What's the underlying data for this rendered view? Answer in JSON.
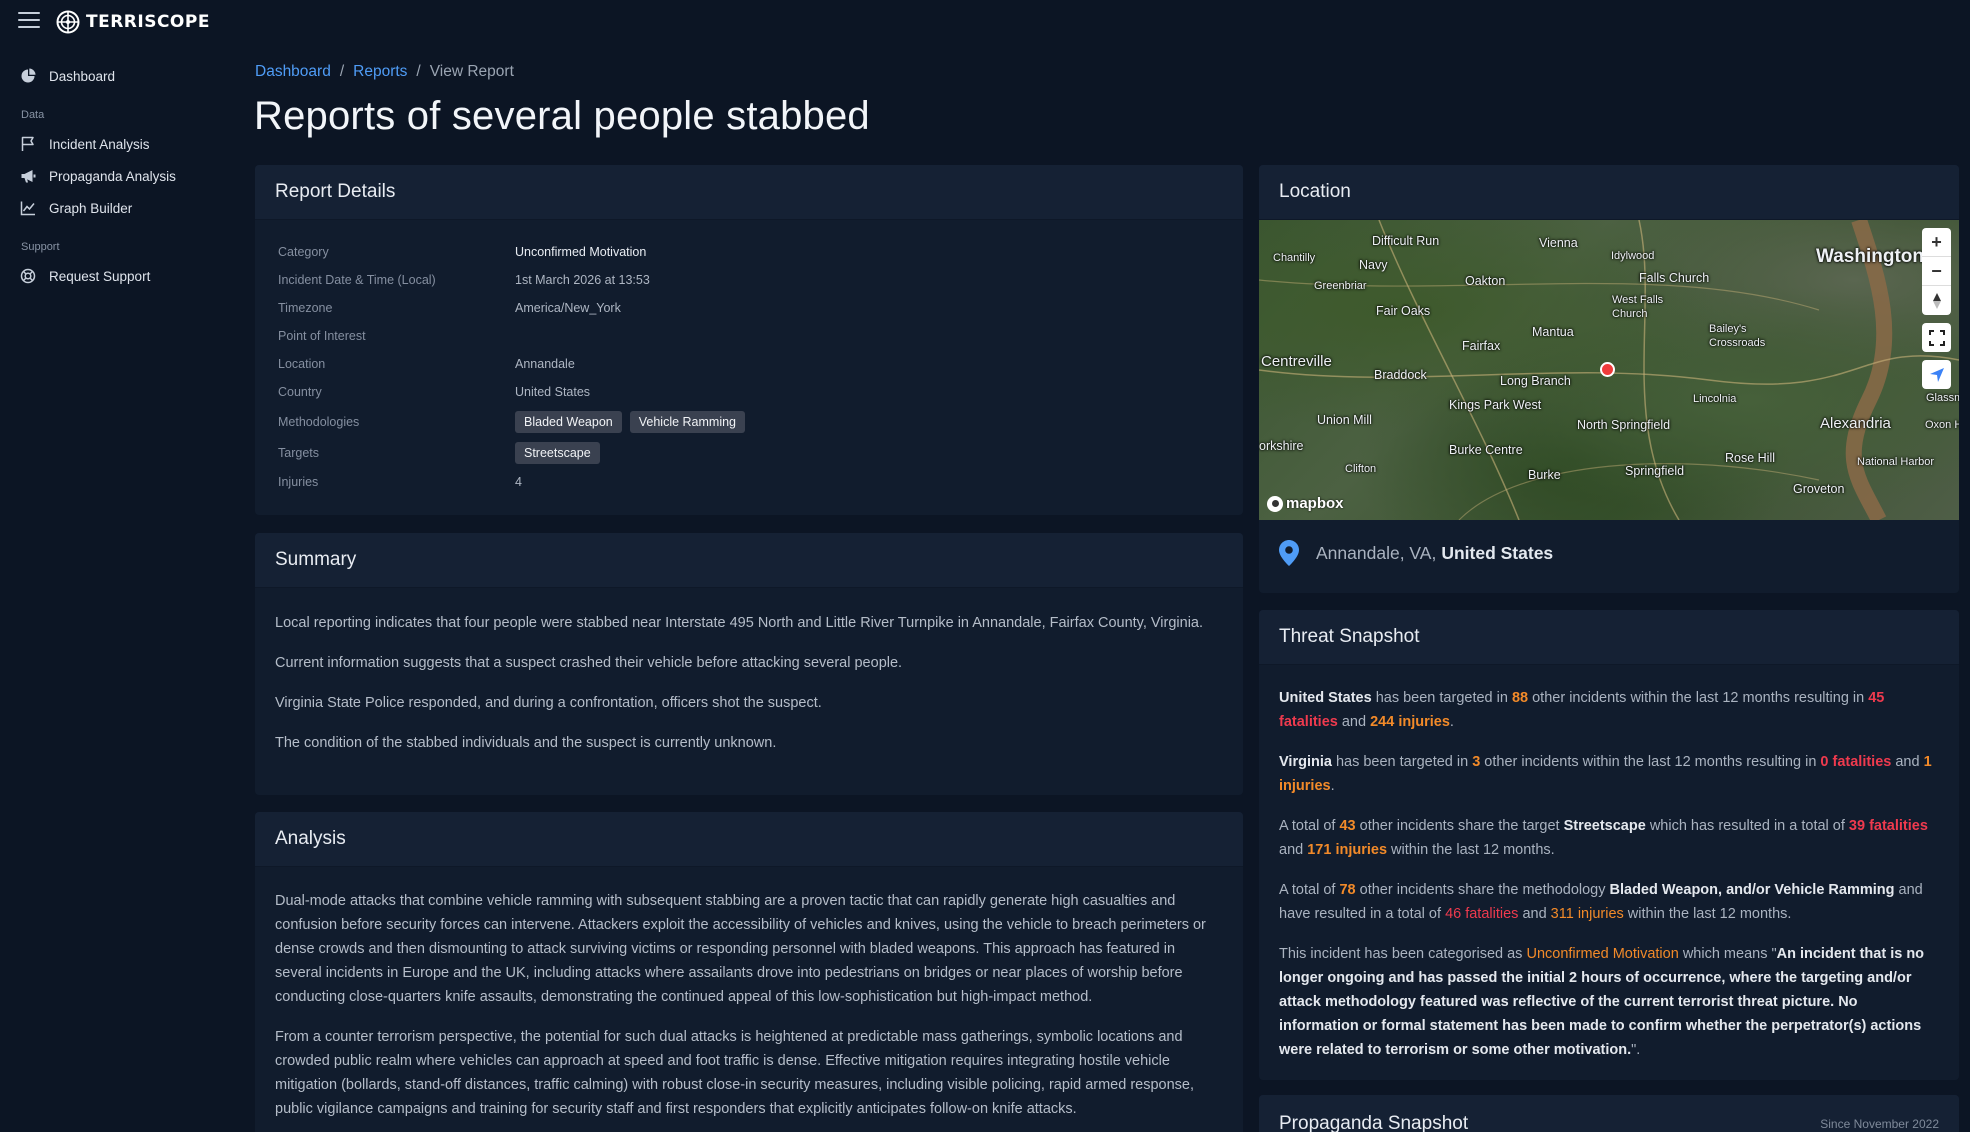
{
  "app": {
    "brand": "TERRISCOPE"
  },
  "sidebar": {
    "items_top": [
      {
        "label": "Dashboard",
        "icon": "pie-chart-icon"
      }
    ],
    "section_data": "Data",
    "items_data": [
      {
        "label": "Incident Analysis",
        "icon": "flag-icon"
      },
      {
        "label": "Propaganda Analysis",
        "icon": "megaphone-icon"
      },
      {
        "label": "Graph Builder",
        "icon": "line-chart-icon"
      }
    ],
    "section_support": "Support",
    "items_support": [
      {
        "label": "Request Support",
        "icon": "lifebuoy-icon"
      }
    ]
  },
  "breadcrumb": {
    "dashboard": "Dashboard",
    "reports": "Reports",
    "current": "View Report",
    "sep": "/"
  },
  "page_title": "Reports of several people stabbed",
  "report_details": {
    "title": "Report Details",
    "rows": {
      "category": {
        "label": "Category",
        "value": "Unconfirmed Motivation"
      },
      "datetime": {
        "label": "Incident Date & Time (Local)",
        "value": "1st March 2026 at 13:53"
      },
      "timezone": {
        "label": "Timezone",
        "value": "America/New_York"
      },
      "poi": {
        "label": "Point of Interest",
        "value": ""
      },
      "location": {
        "label": "Location",
        "value": "Annandale"
      },
      "country": {
        "label": "Country",
        "value": "United States"
      },
      "methodologies": {
        "label": "Methodologies",
        "tags": [
          "Bladed Weapon",
          "Vehicle Ramming"
        ]
      },
      "targets": {
        "label": "Targets",
        "tags": [
          "Streetscape"
        ]
      },
      "injuries": {
        "label": "Injuries",
        "value": "4"
      }
    }
  },
  "summary": {
    "title": "Summary",
    "paragraphs": [
      "Local reporting indicates that four people were stabbed near Interstate 495 North and Little River Turnpike in Annandale, Fairfax County, Virginia.",
      "Current information suggests that a suspect crashed their vehicle before attacking several people.",
      "Virginia State Police responded, and during a confrontation, officers shot the suspect.",
      "The condition of the stabbed individuals and the suspect is currently unknown."
    ]
  },
  "analysis": {
    "title": "Analysis",
    "paragraphs": [
      "Dual-mode attacks that combine vehicle ramming with subsequent stabbing are a proven tactic that can rapidly generate high casualties and confusion before security forces can intervene. Attackers exploit the accessibility of vehicles and knives, using the vehicle to breach perimeters or dense crowds and then dismounting to attack surviving victims or responding personnel with bladed weapons. This approach has featured in several incidents in Europe and the UK, including attacks where assailants drove into pedestrians on bridges or near places of worship before conducting close-quarters knife assaults, demonstrating the continued appeal of this low-sophistication but high-impact method.",
      "From a counter terrorism perspective, the potential for such dual attacks is heightened at predictable mass gatherings, symbolic locations and crowded public realm where vehicles can approach at speed and foot traffic is dense. Effective mitigation requires integrating hostile vehicle mitigation (bollards, stand-off distances, traffic calming) with robust close-in security measures, including visible policing, rapid armed response, public vigilance campaigns and training for security staff and first responders that explicitly anticipates follow-on knife attacks."
    ]
  },
  "location": {
    "title": "Location",
    "place": "Annandale, VA,",
    "country": "United States",
    "attribution": "mapbox",
    "map_labels": [
      "Difficult Run",
      "Vienna",
      "Idylwood",
      "Washington",
      "Chantilly",
      "Navy",
      "Oakton",
      "Falls Church",
      "Greenbriar",
      "West Falls Church",
      "Fair Oaks",
      "Mantua",
      "Bailey's Crossroads",
      "Fairfax",
      "Centreville",
      "Braddock",
      "Long Branch",
      "Glassmanor",
      "Kings Park West",
      "Lincolnia",
      "Union Mill",
      "North Springfield",
      "Alexandria",
      "Oxon H",
      "orkshire",
      "Burke Centre",
      "Rose Hill",
      "National Harbor",
      "Clifton",
      "Springfield",
      "Burke",
      "Groveton"
    ]
  },
  "threat": {
    "title": "Threat Snapshot",
    "p1": {
      "subject": "United States",
      "t1": " has been targeted in ",
      "count": "88",
      "t2": " other incidents within the last 12 months resulting in ",
      "fatal": "45 fatalities",
      "t3": " and ",
      "inj": "244 injuries",
      "t4": "."
    },
    "p2": {
      "subject": "Virginia",
      "t1": " has been targeted in ",
      "count": "3",
      "t2": " other incidents within the last 12 months resulting in ",
      "fatal": "0 fatalities",
      "t3": " and ",
      "inj": "1 injuries",
      "t4": "."
    },
    "p3": {
      "t0": "A total of ",
      "count": "43",
      "t1": " other incidents share the target ",
      "target": "Streetscape",
      "t2": " which has resulted in a total of ",
      "fatal": "39 fatalities",
      "t3": " and ",
      "inj": "171 injuries",
      "t4": " within the last 12 months."
    },
    "p4": {
      "t0": "A total of ",
      "count": "78",
      "t1": " other incidents share the methodology ",
      "method": "Bladed Weapon, and/or Vehicle Ramming",
      "t2": " and have resulted in a total of ",
      "fatal": "46 fatalities",
      "t3": " and ",
      "inj": "311 injuries",
      "t4": " within the last 12 months."
    },
    "p5": {
      "t0": "This incident has been categorised as ",
      "category": "Unconfirmed Motivation",
      "t1": " which means \"",
      "definition": "An incident that is no longer ongoing and has passed the initial 2 hours of occurrence, where the targeting and/or attack methodology featured was reflective of the current terrorist threat picture. No information or formal statement has been made to confirm whether the perpetrator(s) actions were related to terrorism or some other motivation.",
      "t2": "\"."
    }
  },
  "propaganda": {
    "title": "Propaganda Snapshot",
    "since": "Since November 2022"
  },
  "colors": {
    "accent_link": "#4f9cf6",
    "highlight_orange": "#f28a29",
    "highlight_red": "#ef3a4e",
    "background": "#0c1524",
    "card": "#111c2d"
  }
}
